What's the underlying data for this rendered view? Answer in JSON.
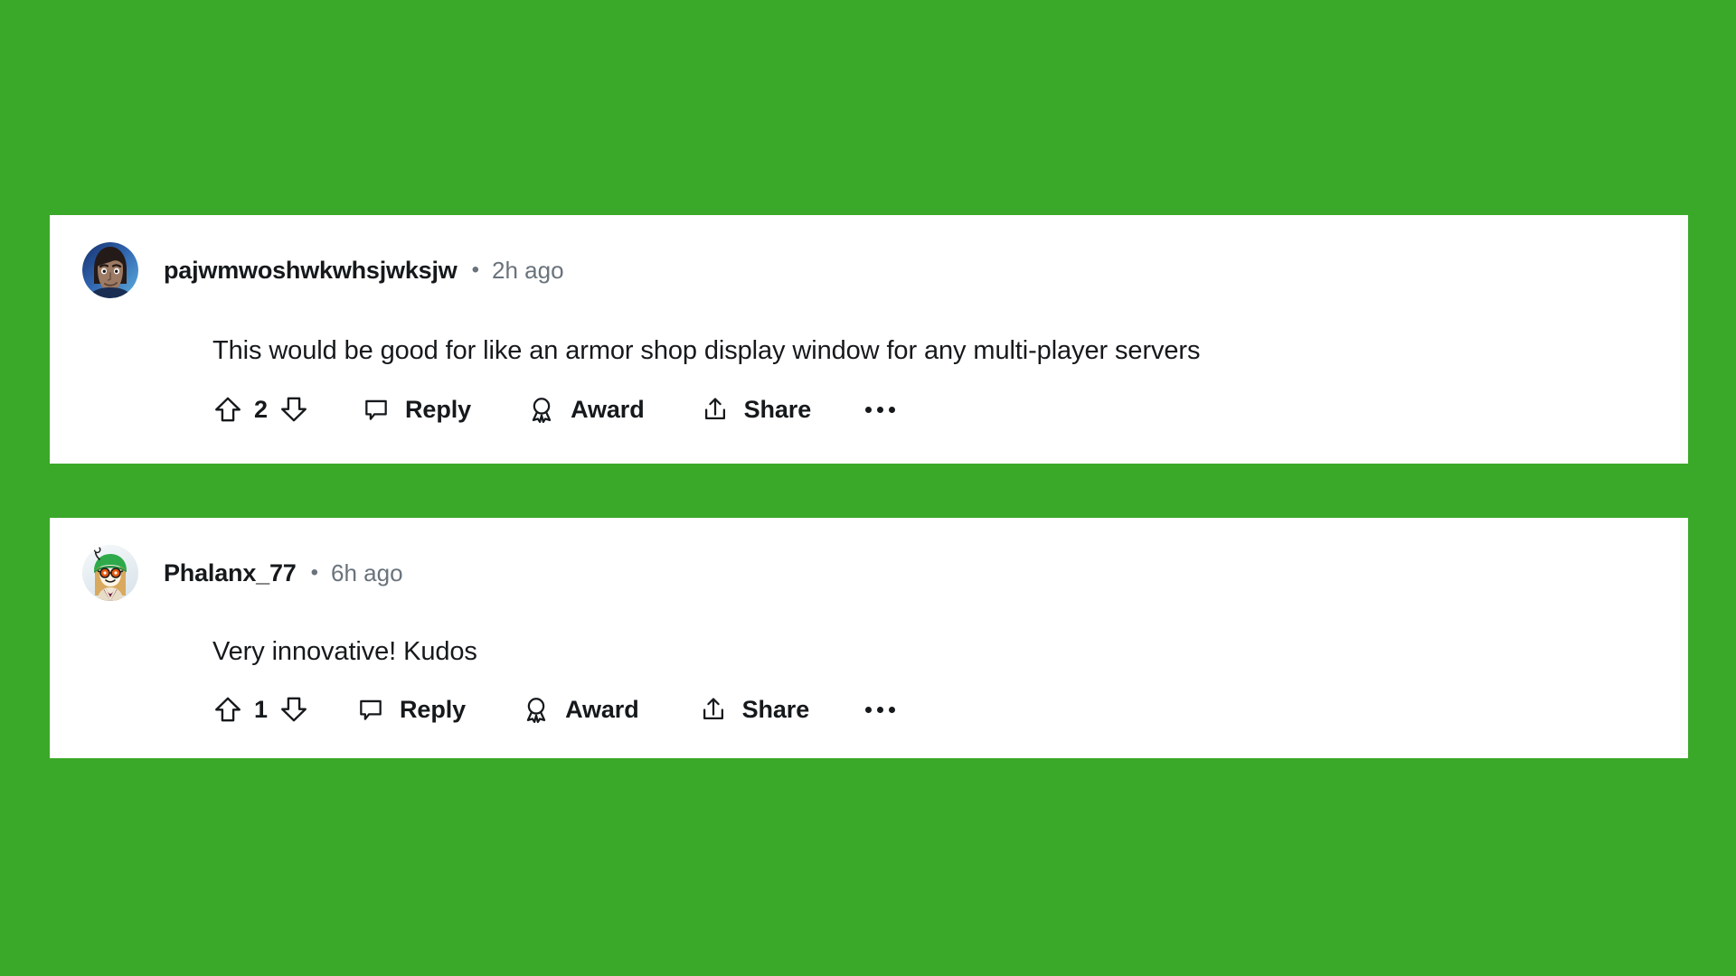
{
  "page": {
    "background_color": "#3aa828",
    "card_background": "#ffffff",
    "text_color": "#16191c",
    "muted_color": "#6a737c"
  },
  "comments": [
    {
      "id": "comment-1",
      "author": "pajwmwoshwkwhsjwksjw",
      "separator": "•",
      "timestamp": "2h ago",
      "body": "This would be good for like an armor shop display window for any multi-player servers",
      "avatar": {
        "name": "user-avatar-pajwmwoshwkwhsjwksjw",
        "description": "dark-haired character with blue gradient background",
        "bg_from": "#1d3f7a",
        "bg_to": "#4a9bd8",
        "skin": "#9c7a63",
        "hair": "#241a18"
      },
      "actions": {
        "upvote_icon": "arrow-up-icon",
        "vote_count": "2",
        "downvote_icon": "arrow-down-icon",
        "reply_icon": "comment-bubble-icon",
        "reply_label": "Reply",
        "award_icon": "award-medal-icon",
        "award_label": "Award",
        "share_icon": "share-upload-icon",
        "share_label": "Share",
        "more_icon": "more-options-icon"
      }
    },
    {
      "id": "comment-2",
      "author": "Phalanx_77",
      "separator": "•",
      "timestamp": "6h ago",
      "body": "Very innovative! Kudos",
      "avatar": {
        "name": "user-avatar-phalanx-77",
        "description": "snoo avatar with green beanie, orange glasses, blonde hair, maroon top",
        "bg_from": "#f2f6f8",
        "bg_to": "#dde6ec",
        "hat": "#2faa4a",
        "glasses": "#d9480f",
        "hair": "#d9a85c",
        "shirt": "#6e1f3f"
      },
      "actions": {
        "upvote_icon": "arrow-up-icon",
        "vote_count": "1",
        "downvote_icon": "arrow-down-icon",
        "reply_icon": "comment-bubble-icon",
        "reply_label": "Reply",
        "award_icon": "award-medal-icon",
        "award_label": "Award",
        "share_icon": "share-upload-icon",
        "share_label": "Share",
        "more_icon": "more-options-icon"
      }
    }
  ]
}
